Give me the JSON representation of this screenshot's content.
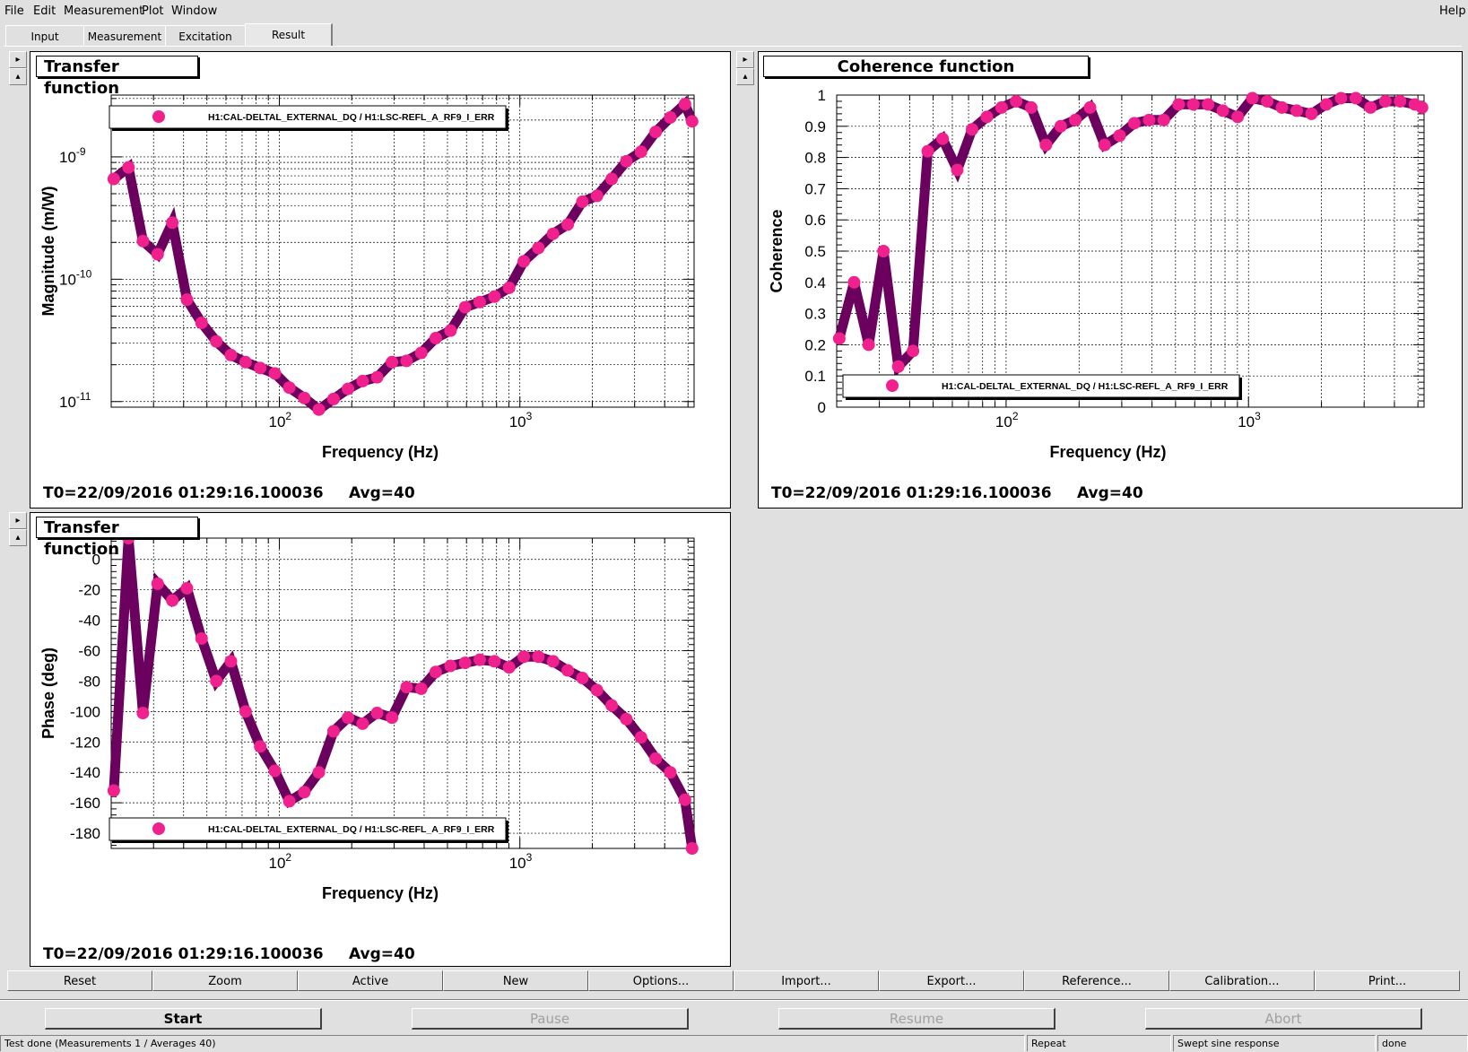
{
  "menu": {
    "file": "File",
    "edit": "Edit",
    "measurement": "Measurement",
    "plot": "Plot",
    "window": "Window",
    "help": "Help"
  },
  "tabs": [
    "Input",
    "Measurement",
    "Excitation",
    "Result"
  ],
  "colors": {
    "line": "#6b005f",
    "marker": "#f0208c",
    "background": "#ffffff",
    "grid": "#000000"
  },
  "pads": {
    "magnitude": {
      "title": "Transfer function",
      "footer_t0": "T0=22/09/2016 01:29:16.100036",
      "footer_avg": "Avg=40"
    },
    "coherence": {
      "title": "Coherence function",
      "footer_t0": "T0=22/09/2016 01:29:16.100036",
      "footer_avg": "Avg=40"
    },
    "phase": {
      "title": "Transfer function",
      "footer_t0": "T0=22/09/2016 01:29:16.100036",
      "footer_avg": "Avg=40"
    }
  },
  "chart_data": [
    {
      "type": "line",
      "title": "Transfer function",
      "xlabel": "Frequency (Hz)",
      "ylabel": "Magnitude (m/W)",
      "xscale": "log",
      "yscale": "log",
      "xlim": [
        20,
        5300
      ],
      "ylim": [
        9e-12,
        3.2e-09
      ],
      "xticks": [
        "10^2",
        "10^3"
      ],
      "yticks": [
        "10^-11",
        "10^-10",
        "10^-9"
      ],
      "legend": "top-left",
      "series": [
        {
          "name": "H1:CAL-DELTAL_EXTERNAL_DQ / H1:LSC-REFL_A_RF9_I_ERR",
          "x": [
            20.5,
            23.6,
            27.1,
            31.2,
            35.9,
            41.3,
            47.5,
            54.7,
            62.9,
            72.4,
            83.3,
            95.8,
            110,
            127,
            146,
            168,
            193,
            222,
            255,
            294,
            338,
            389,
            447,
            515,
            592,
            681,
            784,
            902,
            1038,
            1194,
            1374,
            1581,
            1819,
            2093,
            2408,
            2771,
            3188,
            3669,
            4221,
            4857,
            5200
          ],
          "y": [
            6.6e-10,
            8.2e-10,
            2.05e-10,
            1.6e-10,
            2.9e-10,
            6.8e-11,
            4.4e-11,
            3.1e-11,
            2.4e-11,
            2.1e-11,
            1.88e-11,
            1.7e-11,
            1.3e-11,
            1.07e-11,
            8.6e-12,
            1.05e-11,
            1.27e-11,
            1.47e-11,
            1.58e-11,
            2.1e-11,
            2.15e-11,
            2.5e-11,
            3.3e-11,
            3.8e-11,
            5.9e-11,
            6.5e-11,
            7.2e-11,
            8.5e-11,
            1.4e-10,
            1.8e-10,
            2.35e-10,
            2.8e-10,
            4.3e-10,
            4.8e-10,
            6.6e-10,
            9.2e-10,
            1.1e-09,
            1.6e-09,
            2.1e-09,
            2.7e-09,
            1.95e-09
          ]
        }
      ]
    },
    {
      "type": "line",
      "title": "Coherence function",
      "xlabel": "Frequency (Hz)",
      "ylabel": "Coherence",
      "xscale": "log",
      "xlim": [
        20,
        5300
      ],
      "ylim": [
        0,
        1
      ],
      "xticks": [
        "10^2",
        "10^3"
      ],
      "yticks": [
        "0",
        "0.1",
        "0.2",
        "0.3",
        "0.4",
        "0.5",
        "0.6",
        "0.7",
        "0.8",
        "0.9",
        "1"
      ],
      "legend": "bottom-right",
      "series": [
        {
          "name": "H1:CAL-DELTAL_EXTERNAL_DQ / H1:LSC-REFL_A_RF9_I_ERR",
          "x": [
            20.5,
            23.6,
            27.1,
            31.2,
            35.9,
            41.3,
            47.5,
            54.7,
            62.9,
            72.4,
            83.3,
            95.8,
            110,
            127,
            146,
            168,
            193,
            222,
            255,
            294,
            338,
            389,
            447,
            515,
            592,
            681,
            784,
            902,
            1038,
            1194,
            1374,
            1581,
            1819,
            2093,
            2408,
            2771,
            3188,
            3669,
            4221,
            4857,
            5200
          ],
          "y": [
            0.22,
            0.4,
            0.2,
            0.5,
            0.13,
            0.18,
            0.82,
            0.86,
            0.76,
            0.89,
            0.93,
            0.96,
            0.98,
            0.96,
            0.84,
            0.9,
            0.92,
            0.96,
            0.84,
            0.87,
            0.91,
            0.92,
            0.92,
            0.97,
            0.97,
            0.97,
            0.95,
            0.93,
            0.99,
            0.98,
            0.96,
            0.95,
            0.94,
            0.97,
            0.99,
            0.99,
            0.96,
            0.98,
            0.98,
            0.97,
            0.96
          ]
        }
      ]
    },
    {
      "type": "line",
      "title": "Transfer function",
      "xlabel": "Frequency (Hz)",
      "ylabel": "Phase (deg)",
      "xscale": "log",
      "xlim": [
        20,
        5300
      ],
      "ylim": [
        -190,
        14
      ],
      "xticks": [
        "10^2",
        "10^3"
      ],
      "yticks": [
        "0",
        "-20",
        "-40",
        "-60",
        "-80",
        "-100",
        "-120",
        "-140",
        "-160",
        "-180"
      ],
      "legend": "bottom-left",
      "series": [
        {
          "name": "H1:CAL-DELTAL_EXTERNAL_DQ / H1:LSC-REFL_A_RF9_I_ERR",
          "x": [
            20.5,
            23.6,
            27.1,
            31.2,
            35.9,
            41.3,
            47.5,
            54.7,
            62.9,
            72.4,
            83.3,
            95.8,
            110,
            127,
            146,
            168,
            193,
            222,
            255,
            294,
            338,
            389,
            447,
            515,
            592,
            681,
            784,
            902,
            1038,
            1194,
            1374,
            1581,
            1819,
            2093,
            2408,
            2771,
            3188,
            3669,
            4221,
            4857,
            5200
          ],
          "y": [
            -152,
            14,
            -101,
            -16,
            -27,
            -19,
            -52,
            -80,
            -67,
            -100,
            -123,
            -139,
            -159,
            -153,
            -140,
            -113,
            -104,
            -108,
            -101,
            -104,
            -84,
            -85,
            -74,
            -70,
            -68,
            -66,
            -67,
            -71,
            -64,
            -64,
            -67,
            -73,
            -78,
            -86,
            -96,
            -105,
            -117,
            -131,
            -140,
            -158,
            -190
          ]
        }
      ]
    }
  ],
  "buttons": [
    "Reset",
    "Zoom",
    "Active",
    "New",
    "Options...",
    "Import...",
    "Export...",
    "Reference...",
    "Calibration...",
    "Print..."
  ],
  "controls": {
    "start": "Start",
    "pause": "Pause",
    "resume": "Resume",
    "abort": "Abort"
  },
  "status": {
    "message": "Test done (Measurements 1 / Averages 40)",
    "repeat": "Repeat",
    "type": "Swept sine response",
    "state": "done"
  }
}
